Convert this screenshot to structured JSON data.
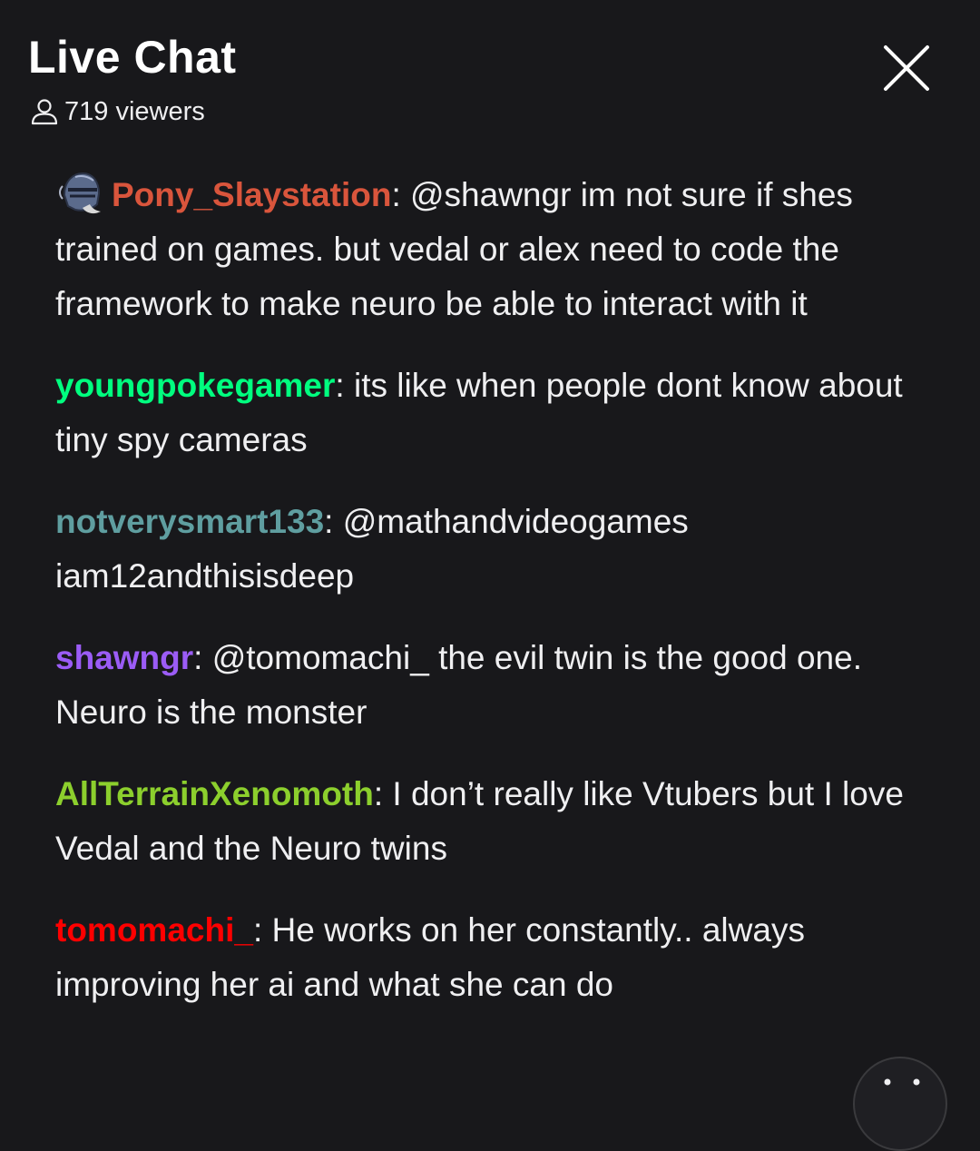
{
  "header": {
    "title": "Live Chat",
    "viewers": "719 viewers"
  },
  "icons": {
    "viewers": "user-icon",
    "close": "close-icon",
    "badge": "knight-helmet-badge-icon",
    "scroll": "scroll-down-icon"
  },
  "colors": {
    "background": "#18181b",
    "text": "#efeff1"
  },
  "messages": [
    {
      "username": "Pony_Slaystation",
      "color": "#d9553c",
      "has_badge": true,
      "text": "@shawngr im not sure if shes trained on games. but vedal or alex need to code the framework to make neuro be able to interact with it"
    },
    {
      "username": "youngpokegamer",
      "color": "#00ff7f",
      "has_badge": false,
      "text": "its like when people dont know about tiny spy cameras"
    },
    {
      "username": "notverysmart133",
      "color": "#5f9ea0",
      "has_badge": false,
      "text": "@mathandvideogames iam12andthisisdeep"
    },
    {
      "username": "shawngr",
      "color": "#9b5cf6",
      "has_badge": false,
      "text": "@tomomachi_ the evil twin is the good one. Neuro is the monster"
    },
    {
      "username": "AllTerrainXenomoth",
      "color": "#8ccf2d",
      "has_badge": false,
      "text": "I don’t really like Vtubers but I love Vedal and the Neuro twins"
    },
    {
      "username": "tomomachi_",
      "color": "#ff0000",
      "has_badge": false,
      "text": "He works on her constantly.. always improving her ai and what she can do"
    }
  ]
}
